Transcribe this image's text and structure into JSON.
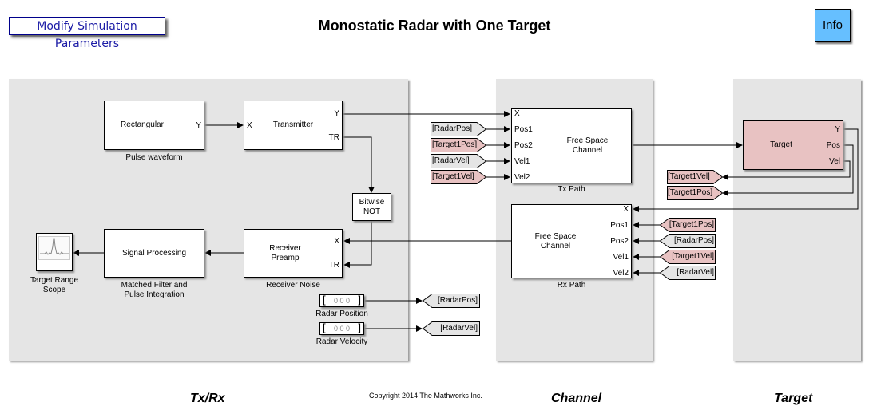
{
  "header": {
    "title": "Monostatic Radar with One Target",
    "modify_button": "Modify Simulation Parameters",
    "info_button": "Info"
  },
  "sections": {
    "txrx": "Tx/Rx",
    "channel": "Channel",
    "target": "Target"
  },
  "copyright": "Copyright 2014 The Mathworks Inc.",
  "colors": {
    "area_bg": "#e5e5e5",
    "target_block": "#e8c2c2",
    "info_button": "#66bfff",
    "modify_button_text": "#1a1aa6"
  },
  "blocks": {
    "pulse": {
      "text": "Rectangular",
      "out": "Y",
      "caption": "Pulse waveform"
    },
    "transmitter": {
      "text": "Transmitter",
      "in": "X",
      "out_y": "Y",
      "out_tr": "TR"
    },
    "bitwise": {
      "line1": "Bitwise",
      "line2": "NOT"
    },
    "signal_processing": {
      "text": "Signal Processing",
      "caption1": "Matched Filter and",
      "caption2": "Pulse Integration"
    },
    "scope": {
      "caption1": "Target Range",
      "caption2": "Scope",
      "icon": "scope-icon"
    },
    "receiver": {
      "line1": "Receiver",
      "line2": "Preamp",
      "in_x": "X",
      "in_tr": "TR",
      "caption": "Receiver Noise"
    },
    "radar_position": {
      "value": "0 0 0",
      "caption": "Radar Position"
    },
    "radar_velocity": {
      "value": "0 0 0",
      "caption": "Radar Velocity"
    },
    "tx_path": {
      "line1": "Free Space",
      "line2": "Channel",
      "ports": [
        "X",
        "Pos1",
        "Pos2",
        "Vel1",
        "Vel2"
      ],
      "caption": "Tx Path"
    },
    "rx_path": {
      "line1": "Free Space",
      "line2": "Channel",
      "ports": [
        "X",
        "Pos1",
        "Pos2",
        "Vel1",
        "Vel2"
      ],
      "caption": "Rx Path"
    },
    "target": {
      "text": "Target",
      "ports": [
        "Y",
        "Pos",
        "Vel"
      ]
    }
  },
  "tags": {
    "tx_from": [
      "[RadarPos]",
      "[Target1Pos]",
      "[RadarVel]",
      "[Target1Vel]"
    ],
    "rx_from": [
      "[Target1Pos]",
      "[RadarPos]",
      "[Target1Vel]",
      "[RadarVel]"
    ],
    "target_goto": [
      "[Target1Vel]",
      "[Target1Pos]"
    ],
    "radar_goto": [
      "[RadarPos]",
      "[RadarVel]"
    ]
  }
}
